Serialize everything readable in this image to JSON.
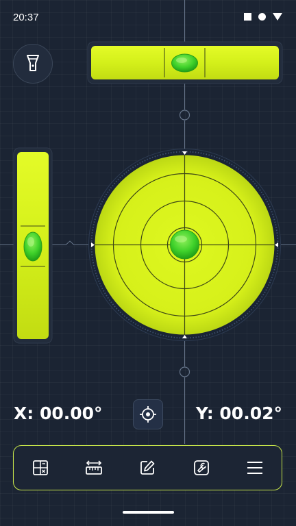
{
  "status_bar": {
    "time": "20:37",
    "icons": [
      "stop-square-icon",
      "record-dot-icon",
      "signal-triangle-icon"
    ]
  },
  "header": {
    "flashlight_icon": "flashlight-icon"
  },
  "levels": {
    "horizontal_bubble_icon": "horizontal-spirit-level",
    "vertical_bubble_icon": "vertical-spirit-level",
    "circular_bubble_icon": "bullseye-level"
  },
  "readouts": {
    "x": "X: 00.00°",
    "y": "Y: 00.02°",
    "x_angle_deg": 0.0,
    "y_angle_deg": 0.02
  },
  "calibrate_icon": "crosshair-icon",
  "toolbar": {
    "items": [
      {
        "icon": "calculator-icon"
      },
      {
        "icon": "ruler-icon"
      },
      {
        "icon": "edit-icon"
      },
      {
        "icon": "tools-icon"
      },
      {
        "icon": "menu-icon"
      }
    ]
  },
  "colors": {
    "background": "#1b2433",
    "accent": "#d8f21a",
    "bubble": "#3fd12a",
    "toolbar_border": "#c9e84a"
  }
}
